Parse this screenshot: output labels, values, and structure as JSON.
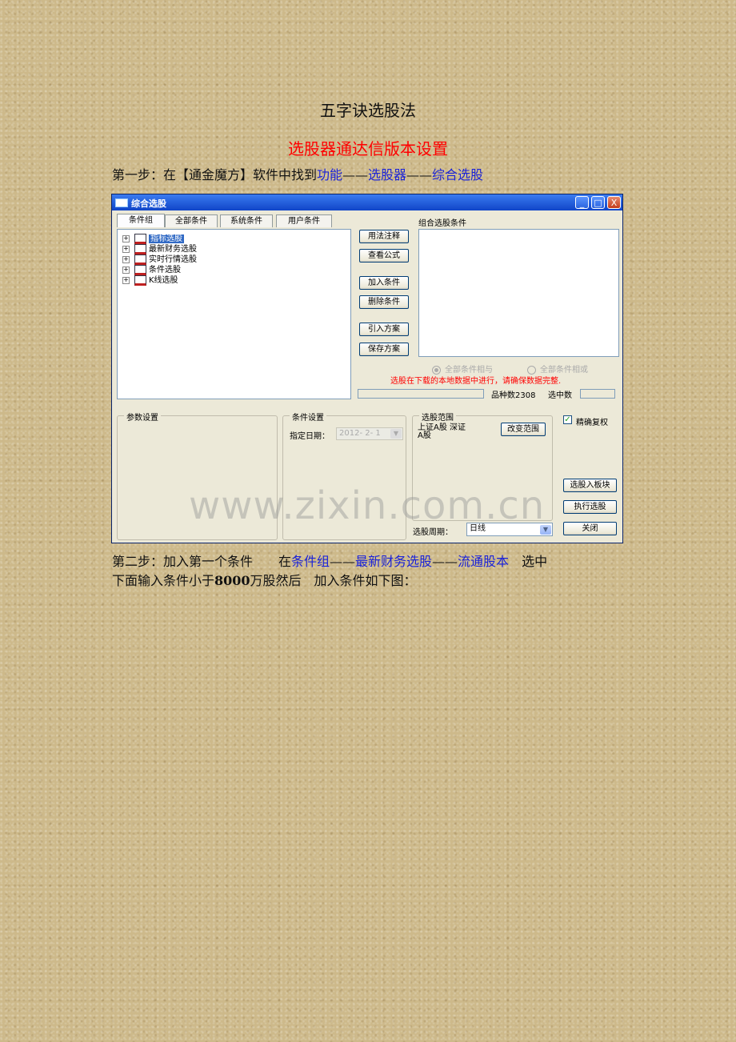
{
  "doc": {
    "title": "五字诀选股法",
    "subtitle": "选股器通达信版本设置",
    "step1": {
      "prefix": "第一步：在【通金魔方】软件中找到",
      "link1": "功能",
      "sep1": "——",
      "link2": "选股器",
      "sep2": "——",
      "link3": "综合选股"
    },
    "step2": {
      "prefix": "第二步：加入第一个条件　　在",
      "link1": "条件组",
      "sep1": "——",
      "link2": "最新财务选股",
      "sep2": "——",
      "link3": "流通股本",
      "suffix": "　选中",
      "line2_a": "下面输入条件小于",
      "line2_num": "8000",
      "line2_b": "万股然后　加入条件如下图："
    }
  },
  "window": {
    "title": "综合选股",
    "controls": {
      "minimize": "_",
      "maximize": "□",
      "close": "X"
    },
    "tabs": [
      "条件组",
      "全部条件",
      "系统条件",
      "用户条件"
    ],
    "tree_items": [
      "指标选股",
      "最新财务选股",
      "实时行情选股",
      "条件选股",
      "K线选股"
    ],
    "buttons": {
      "usage_note": "用法注释",
      "view_formula": "查看公式",
      "add_condition": "加入条件",
      "delete_condition": "删除条件",
      "import_plan": "引入方案",
      "save_plan": "保存方案",
      "change_range": "改变范围",
      "to_block": "选股入板块",
      "execute": "执行选股",
      "close": "关闭"
    },
    "combo_label": "组合选股条件",
    "radio_and": "全部条件相与",
    "radio_or": "全部条件相或",
    "warning": "选股在下载的本地数据中进行，请确保数据完整.",
    "stock_count_label": "品种数",
    "stock_count": "2308",
    "selected_count_label": "选中数",
    "group_params": "参数设置",
    "group_condition": "条件设置",
    "date_label": "指定日期：",
    "date_value": "2012- 2- 1",
    "group_range": "选股范围",
    "range_text_line1": "上证A股 深证",
    "range_text_line2": "A股",
    "checkbox_label": "精确复权",
    "checkbox_checked": true,
    "period_label": "选股周期：",
    "period_value": "日线",
    "watermark": "www.zixin.com.cn"
  }
}
